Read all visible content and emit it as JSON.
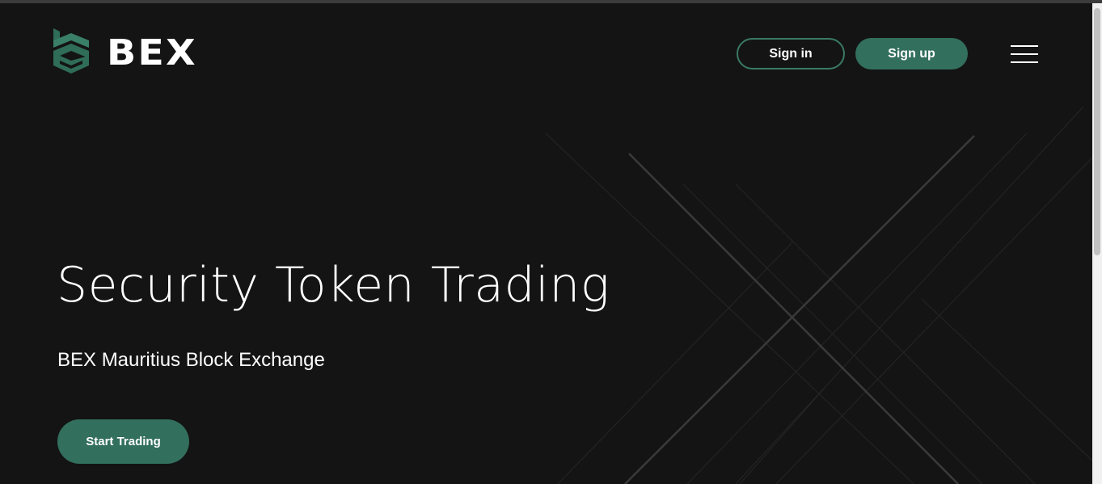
{
  "brand": {
    "name": "BEX",
    "accent_color": "#326f5c",
    "background_color": "#141414"
  },
  "header": {
    "signin_label": "Sign in",
    "signup_label": "Sign up",
    "menu_icon": "hamburger-menu-icon"
  },
  "hero": {
    "title": "Security Token Trading",
    "subtitle": "BEX Mauritius Block Exchange",
    "cta_label": "Start Trading"
  }
}
